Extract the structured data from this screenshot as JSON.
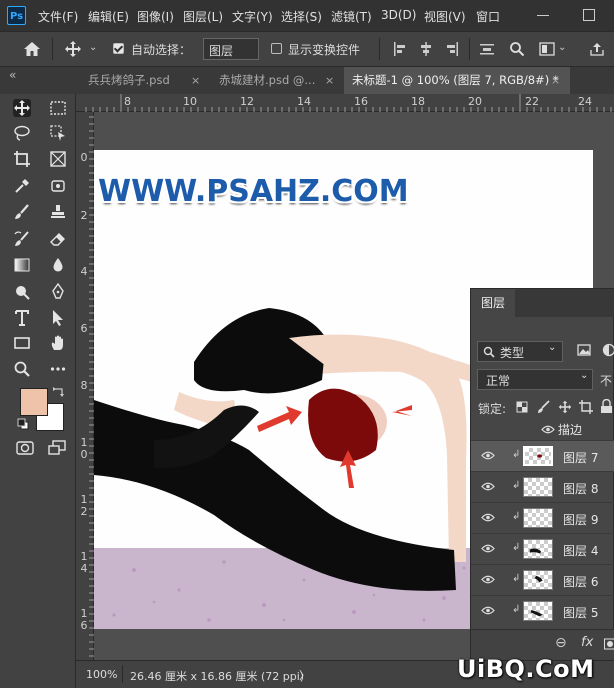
{
  "app": {
    "logo_text": "Ps"
  },
  "menu": [
    "文件(F)",
    "编辑(E)",
    "图像(I)",
    "图层(L)",
    "文字(Y)",
    "选择(S)",
    "滤镜(T)",
    "3D(D)",
    "视图(V)",
    "窗口"
  ],
  "options_bar": {
    "auto_select_label": "自动选择：",
    "auto_select_checked": true,
    "auto_select_target": "图层",
    "show_transform_label": "显示变换控件",
    "show_transform_checked": false
  },
  "tabs": {
    "overflow": "«",
    "items": [
      {
        "label": "兵兵烤鸽子.psd",
        "close": "×",
        "active": false
      },
      {
        "label": "赤城建材.psd @...",
        "close": "×",
        "active": false
      },
      {
        "label": "未标题-1 @ 100% (图层 7, RGB/8#) *",
        "close": "×",
        "active": true
      }
    ]
  },
  "ruler_h": [
    "8",
    "10",
    "12",
    "14",
    "16",
    "18",
    "20",
    "22",
    "24"
  ],
  "ruler_v": [
    "0",
    "2",
    "4",
    "6",
    "8",
    "1\n0",
    "1\n2",
    "1\n4",
    "1\n6"
  ],
  "canvas": {
    "image_text": "WWW.PSAHZ.COM",
    "colors": {
      "dress": "#0c0c0c",
      "hair": "#7c0a0a",
      "skin": "#f3d8c8",
      "floor": "#c9b6cd",
      "arrow": "#e03a2e"
    }
  },
  "colors": {
    "foreground": "#efc3aa",
    "background": "#ffffff"
  },
  "status": {
    "zoom": "100%",
    "doc_info": "26.46 厘米 x 16.86 厘米 (72 ppi)",
    "arrow": "〉"
  },
  "layers_panel": {
    "title": "图层",
    "filter_kind": "类型",
    "blend_mode": "正常",
    "opacity_label": "不",
    "lock_label": "锁定:",
    "effect_label": "描边",
    "layers": [
      {
        "name": "图层 7",
        "visible": true,
        "clipped": true,
        "selected": true
      },
      {
        "name": "图层 8",
        "visible": true,
        "clipped": true,
        "selected": false
      },
      {
        "name": "图层 9",
        "visible": true,
        "clipped": true,
        "selected": false
      },
      {
        "name": "图层 4",
        "visible": true,
        "clipped": true,
        "selected": false
      },
      {
        "name": "图层 6",
        "visible": true,
        "clipped": true,
        "selected": false
      },
      {
        "name": "图层 5",
        "visible": true,
        "clipped": true,
        "selected": false
      }
    ],
    "footer": {
      "link": "⊖",
      "fx": "fx"
    }
  },
  "watermark": "UiBQ.CoM"
}
